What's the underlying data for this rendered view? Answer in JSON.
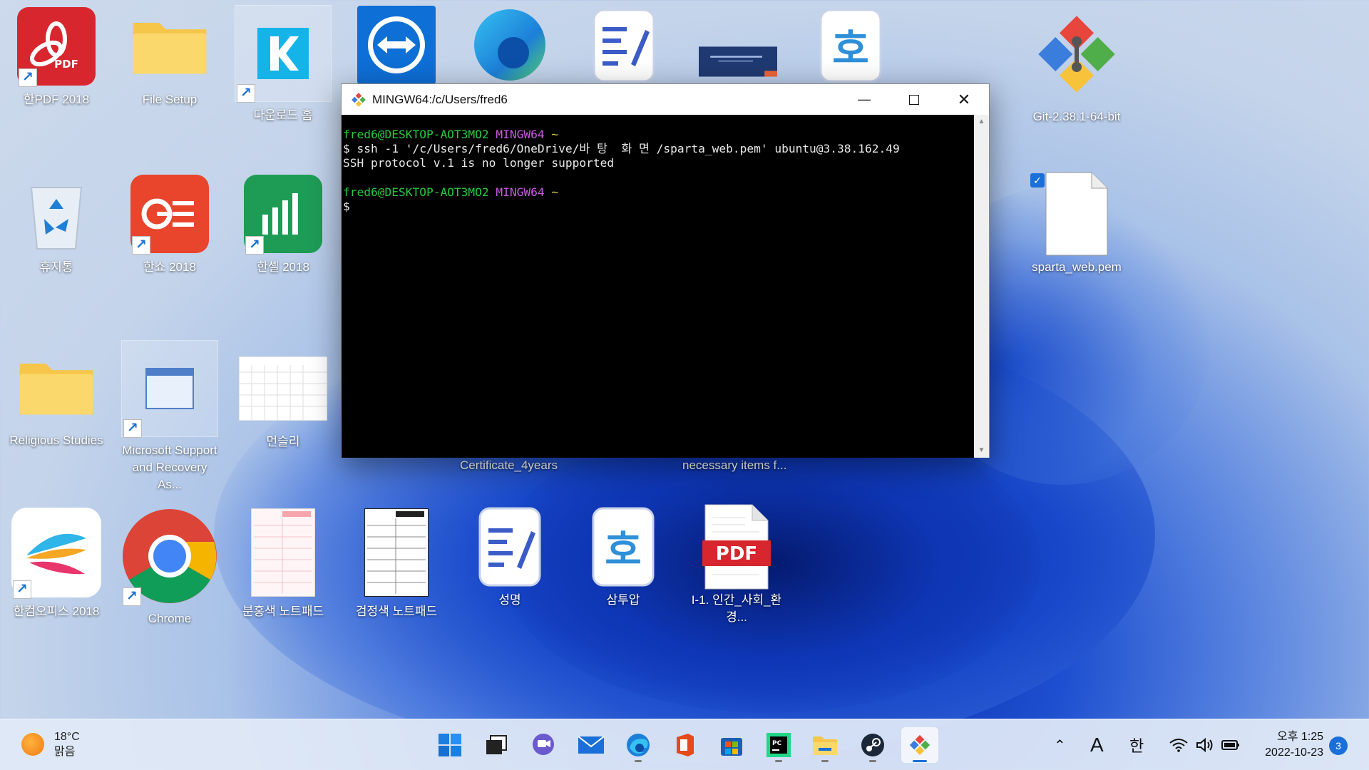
{
  "desktop": {
    "icons": [
      {
        "label": "한PDF 2018"
      },
      {
        "label": "File Setup"
      },
      {
        "label": "다운로드 홈"
      },
      {
        "label": "Git-2.38.1-64-bit"
      },
      {
        "label": "휴지통"
      },
      {
        "label": "한쇼 2018"
      },
      {
        "label": "한셀 2018"
      },
      {
        "label": "sparta_web.pem"
      },
      {
        "label": "Religious Studies"
      },
      {
        "label": "Microsoft Support and Recovery As..."
      },
      {
        "label": "먼슬리"
      },
      {
        "label": "한컴오피스 2018"
      },
      {
        "label": "Chrome"
      },
      {
        "label": "분홍색 노트패드"
      },
      {
        "label": "검정색 노트패드"
      },
      {
        "label": "성명"
      },
      {
        "label": "삼투압"
      },
      {
        "label": "I-1. 인간_사회_환경..."
      }
    ],
    "captions": {
      "certificate": "Certificate_4years",
      "necessary": "necessary items f..."
    },
    "pdf_badge": "PDF",
    "pdf_app_badge": "PDF"
  },
  "terminal": {
    "title": "MINGW64:/c/Users/fred6",
    "prompt_user": "fred6@DESKTOP-AOT3MO2",
    "prompt_env": "MINGW64",
    "prompt_path": "~",
    "command": "$ ssh -1 '/c/Users/fred6/OneDrive/바 탕  화 면 /sparta_web.pem' ubuntu@3.38.162.49",
    "output": "SSH protocol v.1 is no longer supported",
    "prompt2_user": "fred6@DESKTOP-AOT3MO2",
    "prompt2_env": "MINGW64",
    "prompt2_path": "~",
    "cursor_line": "$"
  },
  "taskbar": {
    "weather_temp": "18°C",
    "weather_desc": "맑음",
    "ime_mode": "A",
    "ime_lang": "한",
    "time": "오후 1:25",
    "date": "2022-10-23",
    "notifications": "3",
    "apps": [
      "start-icon",
      "task-view-icon",
      "chat-icon",
      "mail-icon",
      "edge-icon",
      "office-icon",
      "store-icon",
      "pycharm-icon",
      "file-explorer-icon",
      "steam-icon",
      "git-icon"
    ]
  }
}
